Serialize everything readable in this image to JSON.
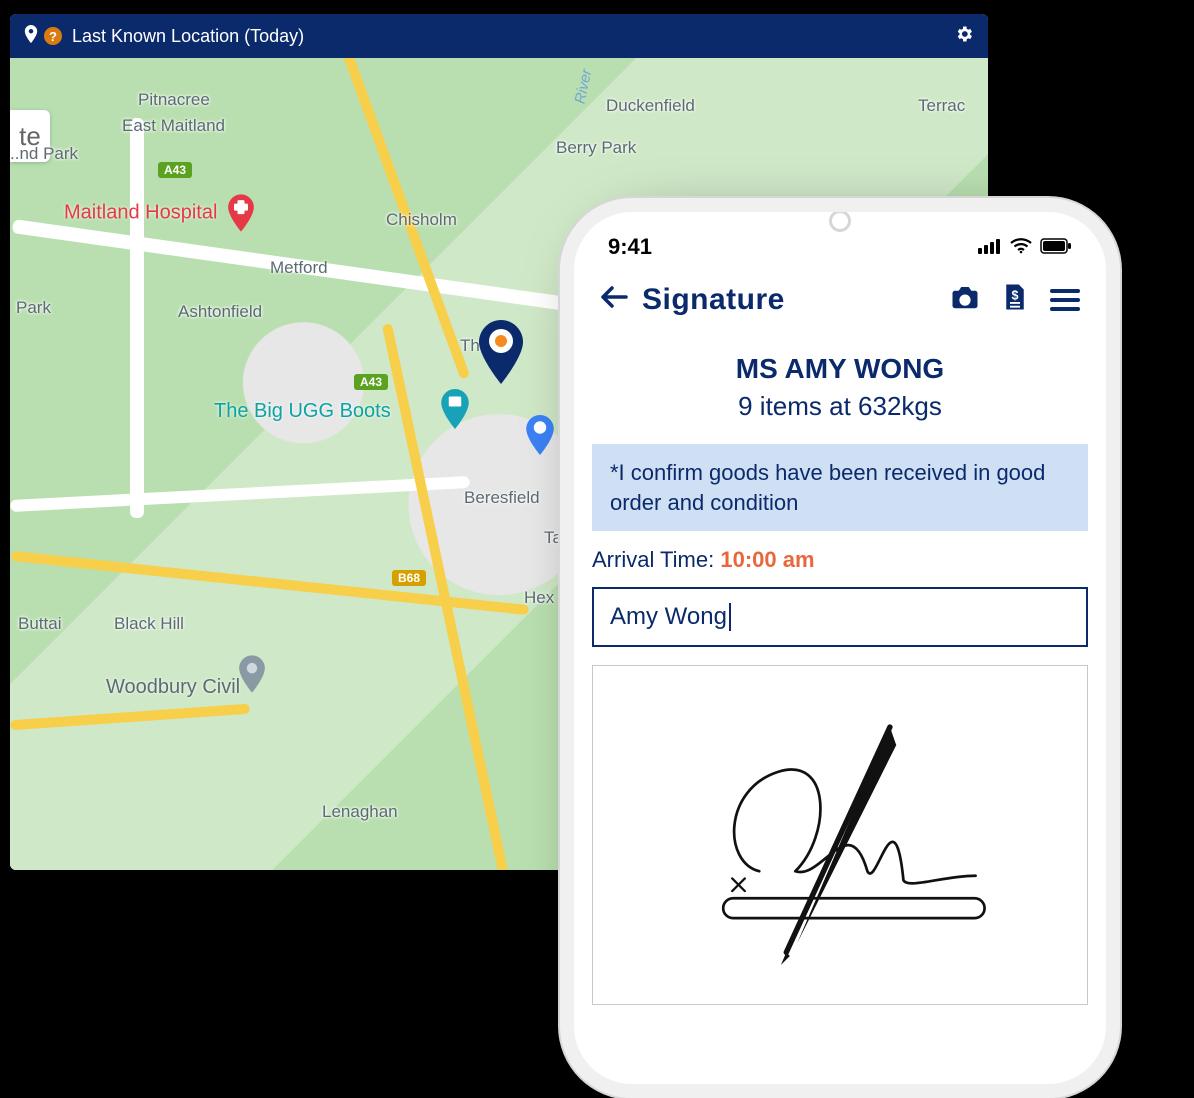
{
  "mapPanel": {
    "title": "Last Known Location (Today)",
    "sideStub": "te",
    "labels": {
      "pitnacree": "Pitnacree",
      "eastMaitland": "East Maitland",
      "park1": "..nd Park",
      "metford": "Metford",
      "ashtonfield": "Ashtonfield",
      "chisholm": "Chisholm",
      "thornton": "Th     nton",
      "beresfield": "Beresfield",
      "tarro": "Ta",
      "hexham": "Hex",
      "buttai": "Buttai",
      "blackHill": "Black Hill",
      "lenaghan": "Lenaghan",
      "duckenfield": "Duckenfield",
      "berryPark": "Berry Park",
      "terrac": "Terrac",
      "park2": "Park",
      "river": "River"
    },
    "poi": {
      "hospital": "Maitland Hospital",
      "ugg": "The Big UGG Boots",
      "woodbury": "Woodbury Civil"
    },
    "routes": {
      "a43a": "A43",
      "a43b": "A43",
      "b68": "B68"
    }
  },
  "phone": {
    "statusTime": "9:41",
    "header": {
      "title": "Signature"
    },
    "customer": {
      "name": "MS AMY WONG",
      "detail": "9 items at 632kgs"
    },
    "confirmText": "*I confirm goods have been received in good order and condition",
    "arrivalLabel": "Arrival Time: ",
    "arrivalTime": "10:00 am",
    "nameInputValue": "Amy Wong"
  }
}
